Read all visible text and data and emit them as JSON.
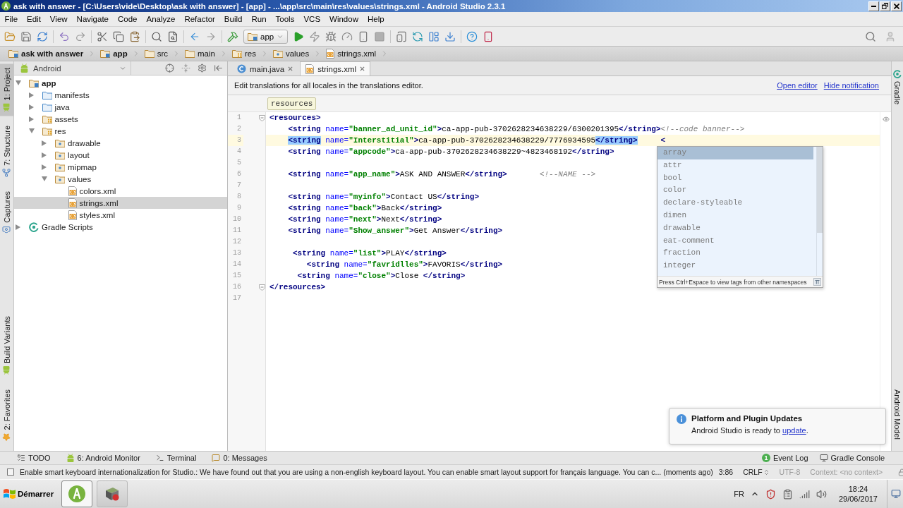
{
  "window": {
    "title": "ask with answer - [C:\\Users\\vide\\Desktop\\ask with answer] - [app] - ...\\app\\src\\main\\res\\values\\strings.xml - Android Studio 2.3.1"
  },
  "menu": [
    "File",
    "Edit",
    "View",
    "Navigate",
    "Code",
    "Analyze",
    "Refactor",
    "Build",
    "Run",
    "Tools",
    "VCS",
    "Window",
    "Help"
  ],
  "toolbar": {
    "run_config": "app"
  },
  "navigation_bar": [
    {
      "label": "ask with answer",
      "kind": "project"
    },
    {
      "label": "app",
      "kind": "module"
    },
    {
      "label": "src",
      "kind": "folder"
    },
    {
      "label": "main",
      "kind": "folder"
    },
    {
      "label": "res",
      "kind": "resource_root"
    },
    {
      "label": "values",
      "kind": "res_folder"
    },
    {
      "label": "strings.xml",
      "kind": "xml"
    }
  ],
  "left_tool_tabs": {
    "top": [
      {
        "label": "1: Project",
        "kind": "project",
        "selected": true
      },
      {
        "label": "7: Structure",
        "kind": "structure",
        "selected": false
      },
      {
        "label": "Captures",
        "kind": "captures",
        "selected": false
      }
    ],
    "bottom": [
      {
        "label": "Build Variants",
        "kind": "build_variants",
        "selected": false
      },
      {
        "label": "2: Favorites",
        "kind": "favorites",
        "selected": false
      }
    ]
  },
  "project_panel": {
    "view": "Android",
    "tree": [
      {
        "label": "app",
        "kind": "module",
        "expanded": true,
        "selected": false,
        "children": [
          {
            "label": "manifests",
            "kind": "source_folder",
            "expanded": false,
            "selected": false
          },
          {
            "label": "java",
            "kind": "source_folder",
            "expanded": false,
            "selected": false
          },
          {
            "label": "assets",
            "kind": "resource_root",
            "expanded": false,
            "selected": false
          },
          {
            "label": "res",
            "kind": "resource_root",
            "expanded": true,
            "selected": false,
            "children": [
              {
                "label": "drawable",
                "kind": "res_folder",
                "expanded": false,
                "selected": false
              },
              {
                "label": "layout",
                "kind": "res_folder",
                "expanded": false,
                "selected": false
              },
              {
                "label": "mipmap",
                "kind": "res_folder",
                "expanded": false,
                "selected": false
              },
              {
                "label": "values",
                "kind": "res_folder",
                "expanded": true,
                "selected": false,
                "children": [
                  {
                    "label": "colors.xml",
                    "kind": "xml",
                    "selected": false
                  },
                  {
                    "label": "strings.xml",
                    "kind": "xml",
                    "selected": true
                  },
                  {
                    "label": "styles.xml",
                    "kind": "xml",
                    "selected": false
                  }
                ]
              }
            ]
          }
        ]
      },
      {
        "label": "Gradle Scripts",
        "kind": "gradle",
        "expanded": false,
        "selected": false
      }
    ]
  },
  "editor": {
    "tabs": [
      {
        "label": "main.java",
        "kind": "java",
        "selected": false
      },
      {
        "label": "strings.xml",
        "kind": "xml",
        "selected": true
      }
    ],
    "banner": {
      "text": "Edit translations for all locales in the translations editor.",
      "links": [
        "Open editor",
        "Hide notification"
      ]
    },
    "breadcrumb": "resources",
    "lines": [
      {
        "number": "1",
        "current": false,
        "segments": [
          {
            "kind": "tag",
            "text": "<resources>"
          }
        ]
      },
      {
        "number": "2",
        "current": false,
        "segments": [
          {
            "kind": "tag",
            "text": "<string"
          },
          {
            "kind": "attr",
            "text": " name="
          },
          {
            "kind": "value",
            "text": "\"banner_ad_unit_id\""
          },
          {
            "kind": "tag",
            "text": ">"
          },
          {
            "kind": "text",
            "text": "ca-app-pub-3702628234638229/6300201395"
          },
          {
            "kind": "tag",
            "text": "</string>"
          },
          {
            "kind": "comment",
            "text": "<!--code banner-->"
          }
        ]
      },
      {
        "number": "3",
        "current": true,
        "segments": [
          {
            "kind": "matched_tag",
            "text": "<string"
          },
          {
            "kind": "attr",
            "text": " name="
          },
          {
            "kind": "value",
            "text": "\"Interstitial\""
          },
          {
            "kind": "tag",
            "text": ">"
          },
          {
            "kind": "text",
            "text": "ca-app-pub-3702628234638229/7776934595"
          },
          {
            "kind": "matched_tag",
            "text": "</string>"
          },
          {
            "kind": "tag",
            "text": "     <"
          }
        ]
      },
      {
        "number": "4",
        "current": false,
        "segments": [
          {
            "kind": "tag",
            "text": "<string"
          },
          {
            "kind": "attr",
            "text": " name="
          },
          {
            "kind": "value",
            "text": "\"appcode\""
          },
          {
            "kind": "tag",
            "text": ">"
          },
          {
            "kind": "text",
            "text": "ca-app-pub-3702628234638229~4823468192"
          },
          {
            "kind": "tag",
            "text": "</string>"
          }
        ]
      },
      {
        "number": "5",
        "current": false
      },
      {
        "number": "6",
        "current": false,
        "segments": [
          {
            "kind": "tag",
            "text": "<string"
          },
          {
            "kind": "attr",
            "text": " name="
          },
          {
            "kind": "value",
            "text": "\"app_name\""
          },
          {
            "kind": "tag",
            "text": ">"
          },
          {
            "kind": "text",
            "text": "ASK AND ANSWER"
          },
          {
            "kind": "tag",
            "text": "</string>"
          },
          {
            "kind": "comment",
            "text": "       <!--NAME -->"
          }
        ]
      },
      {
        "number": "7",
        "current": false
      },
      {
        "number": "8",
        "current": false,
        "segments": [
          {
            "kind": "tag",
            "text": "<string"
          },
          {
            "kind": "attr",
            "text": " name="
          },
          {
            "kind": "value",
            "text": "\"myinfo\""
          },
          {
            "kind": "tag",
            "text": ">"
          },
          {
            "kind": "text",
            "text": "Contact US"
          },
          {
            "kind": "tag",
            "text": "</string>"
          }
        ]
      },
      {
        "number": "9",
        "current": false,
        "segments": [
          {
            "kind": "tag",
            "text": "<string"
          },
          {
            "kind": "attr",
            "text": " name="
          },
          {
            "kind": "value",
            "text": "\"back\""
          },
          {
            "kind": "tag",
            "text": ">"
          },
          {
            "kind": "text",
            "text": "Back"
          },
          {
            "kind": "tag",
            "text": "</string>"
          }
        ]
      },
      {
        "number": "10",
        "current": false,
        "segments": [
          {
            "kind": "tag",
            "text": "<string"
          },
          {
            "kind": "attr",
            "text": " name="
          },
          {
            "kind": "value",
            "text": "\"next\""
          },
          {
            "kind": "tag",
            "text": ">"
          },
          {
            "kind": "text",
            "text": "Next"
          },
          {
            "kind": "tag",
            "text": "</string>"
          }
        ]
      },
      {
        "number": "11",
        "current": false,
        "segments": [
          {
            "kind": "tag",
            "text": "<string"
          },
          {
            "kind": "attr",
            "text": " name="
          },
          {
            "kind": "value",
            "text": "\"Show_answer\""
          },
          {
            "kind": "tag",
            "text": ">"
          },
          {
            "kind": "text",
            "text": "Get Answer"
          },
          {
            "kind": "tag",
            "text": "</string>"
          }
        ]
      },
      {
        "number": "12",
        "current": false
      },
      {
        "number": "13",
        "current": false,
        "segments": [
          {
            "kind": "tag",
            "text": "<string"
          },
          {
            "kind": "attr",
            "text": " name="
          },
          {
            "kind": "value",
            "text": "\"list\""
          },
          {
            "kind": "tag",
            "text": ">"
          },
          {
            "kind": "text",
            "text": "PLAY"
          },
          {
            "kind": "tag",
            "text": "</string>"
          }
        ]
      },
      {
        "number": "14",
        "current": false,
        "segments": [
          {
            "kind": "tag",
            "text": "<string"
          },
          {
            "kind": "attr",
            "text": " name="
          },
          {
            "kind": "value",
            "text": "\"favridlles\""
          },
          {
            "kind": "tag",
            "text": ">"
          },
          {
            "kind": "text",
            "text": "FAVORIS"
          },
          {
            "kind": "tag",
            "text": "</string>"
          }
        ]
      },
      {
        "number": "15",
        "current": false,
        "segments": [
          {
            "kind": "tag",
            "text": "<string"
          },
          {
            "kind": "attr",
            "text": " name="
          },
          {
            "kind": "value",
            "text": "\"close\""
          },
          {
            "kind": "tag",
            "text": ">"
          },
          {
            "kind": "text",
            "text": "Close "
          },
          {
            "kind": "tag",
            "text": "</string>"
          }
        ]
      },
      {
        "number": "16",
        "current": false,
        "segments": [
          {
            "kind": "tag",
            "text": "</resources>"
          }
        ]
      },
      {
        "number": "17",
        "current": false
      }
    ]
  },
  "completion_popup": {
    "items": [
      {
        "label": "array",
        "selected": true
      },
      {
        "label": "attr",
        "selected": false
      },
      {
        "label": "bool",
        "selected": false
      },
      {
        "label": "color",
        "selected": false
      },
      {
        "label": "declare-styleable",
        "selected": false
      },
      {
        "label": "dimen",
        "selected": false
      },
      {
        "label": "drawable",
        "selected": false
      },
      {
        "label": "eat-comment",
        "selected": false
      },
      {
        "label": "fraction",
        "selected": false
      },
      {
        "label": "integer",
        "selected": false
      }
    ],
    "hint": "Press Ctrl+Espace to view tags from other namespaces"
  },
  "right_tool_tabs": {
    "top": [
      {
        "label": "Gradle",
        "kind": "gradle"
      }
    ],
    "bottom": [
      {
        "label": "Android Model"
      }
    ]
  },
  "notification": {
    "title": "Platform and Plugin Updates",
    "text_before": "Android Studio is ready to ",
    "link": "update",
    "text_after": "."
  },
  "bottom_tool_tabs": {
    "left": [
      {
        "label": "TODO",
        "kind": "todo"
      },
      {
        "label": "6: Android Monitor",
        "kind": "android_monitor"
      },
      {
        "label": "Terminal",
        "kind": "terminal"
      },
      {
        "label": "0: Messages",
        "kind": "messages"
      }
    ],
    "right": [
      {
        "label": "Event Log",
        "kind": "event_log",
        "badge": "1"
      },
      {
        "label": "Gradle Console",
        "kind": "gradle_console"
      }
    ]
  },
  "status_bar": {
    "message": "Enable smart keyboard internationalization for Studio.: We have found out that you are using a non-english keyboard layout. You can enable smart layout support for français language. You can c... (moments ago)",
    "widgets": [
      {
        "label": "3:86",
        "kind": "position",
        "disabled": false
      },
      {
        "label": "CRLF",
        "kind": "line_separator",
        "disabled": false
      },
      {
        "label": "UTF-8",
        "kind": "encoding",
        "disabled": true
      },
      {
        "label": "Context: <no context>",
        "kind": "context",
        "disabled": true
      }
    ]
  },
  "taskbar": {
    "start": "Démarrer",
    "tasks": [
      {
        "kind": "android_studio",
        "selected": true
      },
      {
        "kind": "app",
        "selected": false
      }
    ],
    "language": "FR",
    "time": "18:24",
    "date": "29/06/2017"
  }
}
